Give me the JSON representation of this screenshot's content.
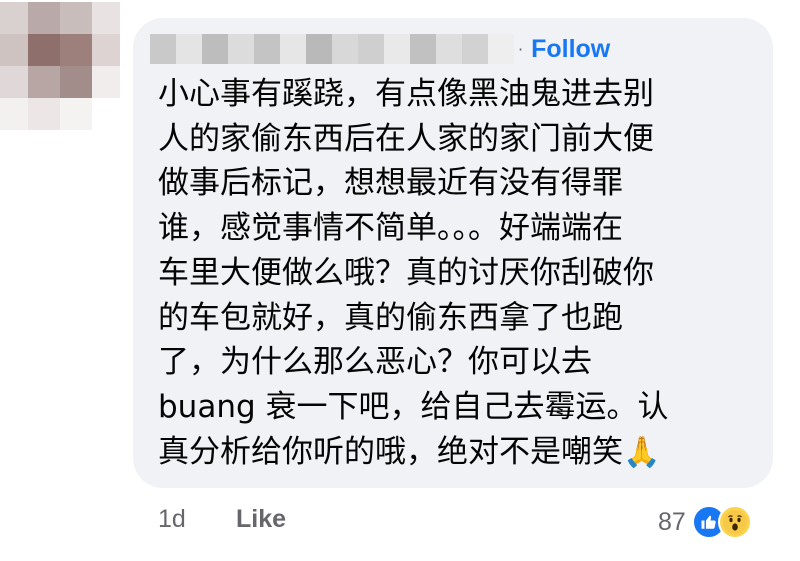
{
  "colors": {
    "accent": "#1877f2",
    "bubble": "#f0f2f5",
    "secondary_text": "#65676b"
  },
  "comment": {
    "author_separator": "·",
    "follow_label": "Follow",
    "text": "小心事有蹊跷，有点像黑油鬼进去别\n人的家偷东西后在人家的家门前大便\n做事后标记，想想最近有没有得罪\n谁，感觉事情不简单。。。好端端在\n车里大便做么哦？真的讨厌你刮破你\n的车包就好，真的偷东西拿了也跑\n了，为什么那么恶心？你可以去\nbuang 衰一下吧，给自己去霉运。认\n真分析给你听的哦，绝对不是嘲笑",
    "emoji": "🙏"
  },
  "footer": {
    "timestamp": "1d",
    "like_label": "Like",
    "reaction_count": "87",
    "reaction_icons": [
      "thumbs-up-icon",
      "wow-icon"
    ]
  }
}
